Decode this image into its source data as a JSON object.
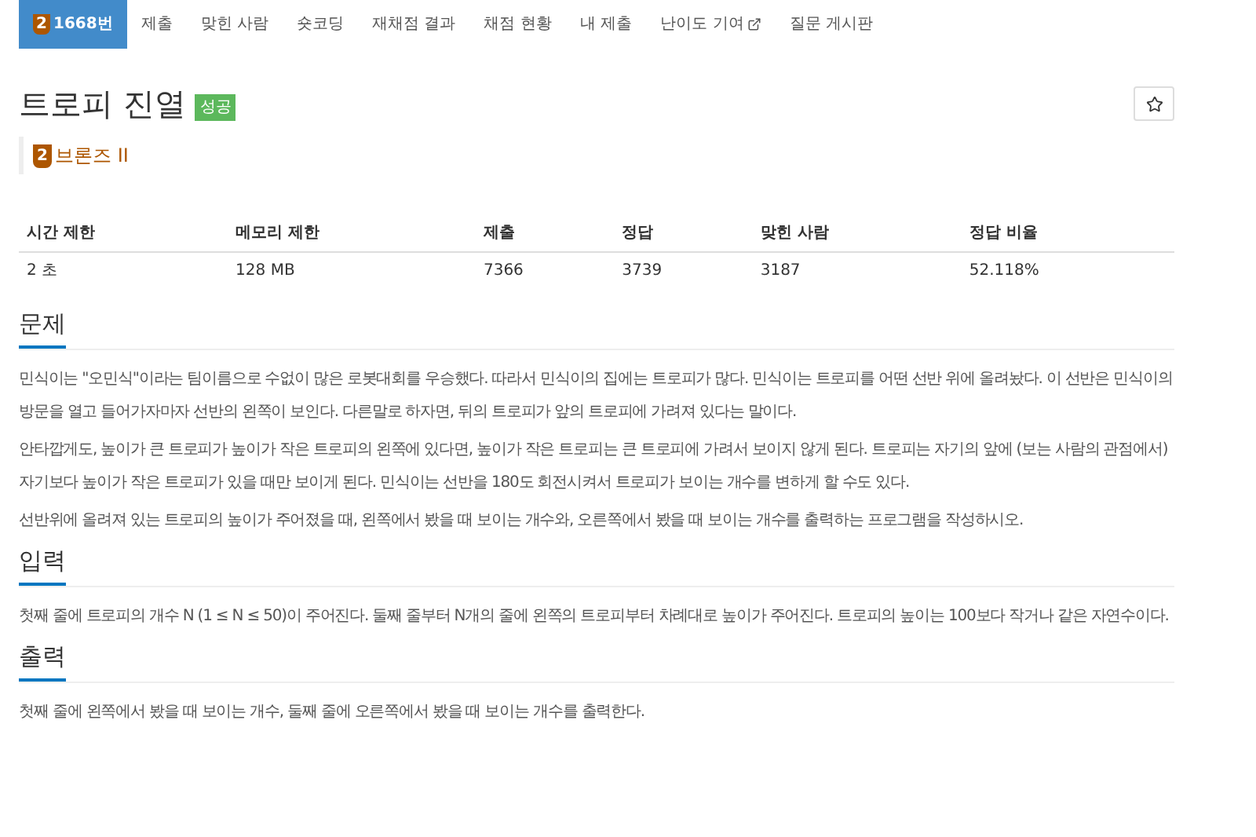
{
  "nav": [
    {
      "label": "1668번",
      "badge": "2",
      "selected": true,
      "external": false
    },
    {
      "label": "제출",
      "selected": false,
      "external": false
    },
    {
      "label": "맞힌 사람",
      "selected": false,
      "external": false
    },
    {
      "label": "숏코딩",
      "selected": false,
      "external": false
    },
    {
      "label": "재채점 결과",
      "selected": false,
      "external": false
    },
    {
      "label": "채점 현황",
      "selected": false,
      "external": false
    },
    {
      "label": "내 제출",
      "selected": false,
      "external": false
    },
    {
      "label": "난이도 기여",
      "selected": false,
      "external": true
    },
    {
      "label": "질문 게시판",
      "selected": false,
      "external": false
    }
  ],
  "problem": {
    "title": "트로피 진열",
    "status": "성공",
    "starred": false,
    "tier": {
      "badge": "2",
      "label": "브론즈 II"
    }
  },
  "table": {
    "columns": [
      "시간 제한",
      "메모리 제한",
      "제출",
      "정답",
      "맞힌 사람",
      "정답 비율"
    ],
    "rows": [
      [
        "2 초",
        "128 MB",
        "7366",
        "3739",
        "3187",
        "52.118%"
      ]
    ]
  },
  "sections": [
    {
      "heading": "문제",
      "paragraphs": [
        "민식이는 \"오민식\"이라는 팀이름으로 수없이 많은 로봇대회를 우승했다. 따라서 민식이의 집에는 트로피가 많다. 민식이는 트로피를 어떤 선반 위에 올려놨다. 이 선반은 민식이의 방문을 열고 들어가자마자 선반의 왼쪽이 보인다. 다른말로 하자면, 뒤의 트로피가 앞의 트로피에 가려져 있다는 말이다.",
        "안타깝게도, 높이가 큰 트로피가 높이가 작은 트로피의 왼쪽에 있다면, 높이가 작은 트로피는 큰 트로피에 가려서 보이지 않게 된다. 트로피는 자기의 앞에 (보는 사람의 관점에서) 자기보다 높이가 작은 트로피가 있을 때만 보이게 된다. 민식이는 선반을 180도 회전시켜서 트로피가 보이는 개수를 변하게 할 수도 있다.",
        "선반위에 올려져 있는 트로피의 높이가 주어졌을 때, 왼쪽에서 봤을 때 보이는 개수와, 오른쪽에서 봤을 때 보이는 개수를 출력하는 프로그램을 작성하시오."
      ]
    },
    {
      "heading": "입력",
      "paragraphs": [
        "첫째 줄에 트로피의 개수 N (1 ≤ N ≤ 50)이 주어진다. 둘째 줄부터 N개의 줄에 왼쪽의 트로피부터 차례대로 높이가 주어진다. 트로피의 높이는 100보다 작거나 같은 자연수이다."
      ]
    },
    {
      "heading": "출력",
      "paragraphs": [
        "첫째 줄에 왼쪽에서 봤을 때 보이는 개수, 둘째 줄에 오른쪽에서 봤을 때 보이는 개수를 출력한다."
      ]
    }
  ]
}
